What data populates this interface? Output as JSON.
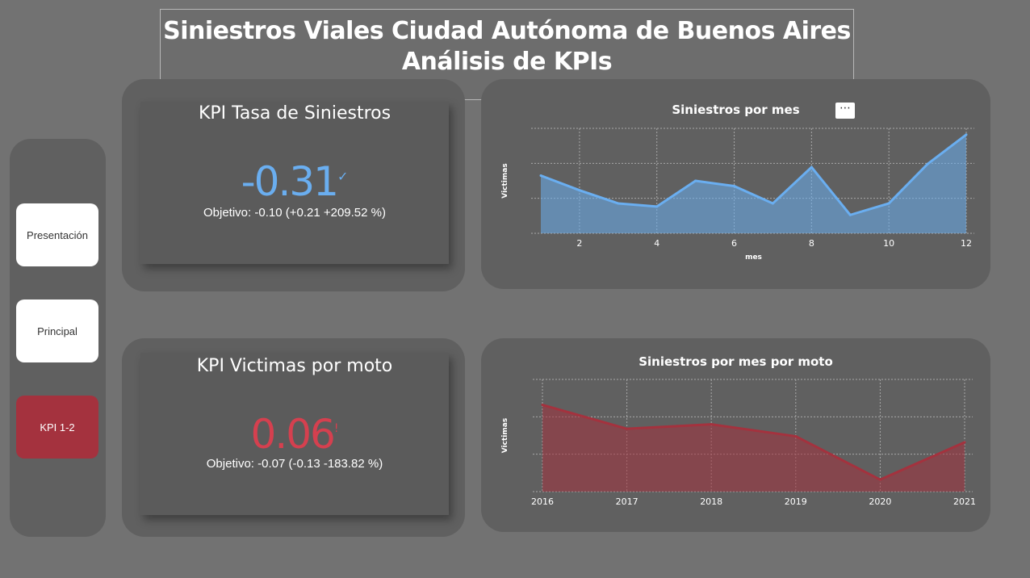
{
  "header": {
    "title_line1": "Siniestros Viales Ciudad Autónoma de Buenos Aires",
    "title_line2": "Análisis de KPIs"
  },
  "nav": {
    "items": [
      {
        "label": "Presentación",
        "active": false
      },
      {
        "label": "Principal",
        "active": false
      },
      {
        "label": "KPI 1-2",
        "active": true
      }
    ]
  },
  "kpi1": {
    "title": "KPI Tasa de Siniestros",
    "value": "-0.31",
    "status_mark": "✓",
    "target": "Objetivo: -0.10 (+0.21 +209.52 %)",
    "color": "#6aaef0"
  },
  "kpi2": {
    "title": "KPI Victimas por moto",
    "value": "0.06",
    "status_mark": "!",
    "target": "Objetivo: -0.07 (-0.13 -183.82 %)",
    "color": "#d5404f"
  },
  "chart_data": [
    {
      "type": "area",
      "title": "Siniestros por mes",
      "xlabel": "mes",
      "ylabel": "Victimas",
      "x": [
        1,
        2,
        3,
        4,
        5,
        6,
        7,
        8,
        9,
        10,
        11,
        12
      ],
      "xticks": [
        2,
        4,
        6,
        8,
        10,
        12
      ],
      "series": [
        {
          "values": [
            110,
            82,
            57,
            51,
            100,
            90,
            57,
            126,
            35,
            57,
            132,
            188
          ]
        }
      ],
      "ylim": [
        0,
        200
      ],
      "grid": true,
      "color": "#6aaef0",
      "more_label": "⋯"
    },
    {
      "type": "area",
      "title": "Siniestros por mes por moto",
      "xlabel": "",
      "ylabel": "Victimas",
      "x": [
        2016,
        2017,
        2018,
        2019,
        2020,
        2021
      ],
      "xticks": [
        2016,
        2017,
        2018,
        2019,
        2020,
        2021
      ],
      "series": [
        {
          "values": [
            58,
            42,
            45,
            37,
            8,
            33
          ]
        }
      ],
      "ylim": [
        0,
        75
      ],
      "grid": true,
      "color": "#a4323e"
    }
  ]
}
